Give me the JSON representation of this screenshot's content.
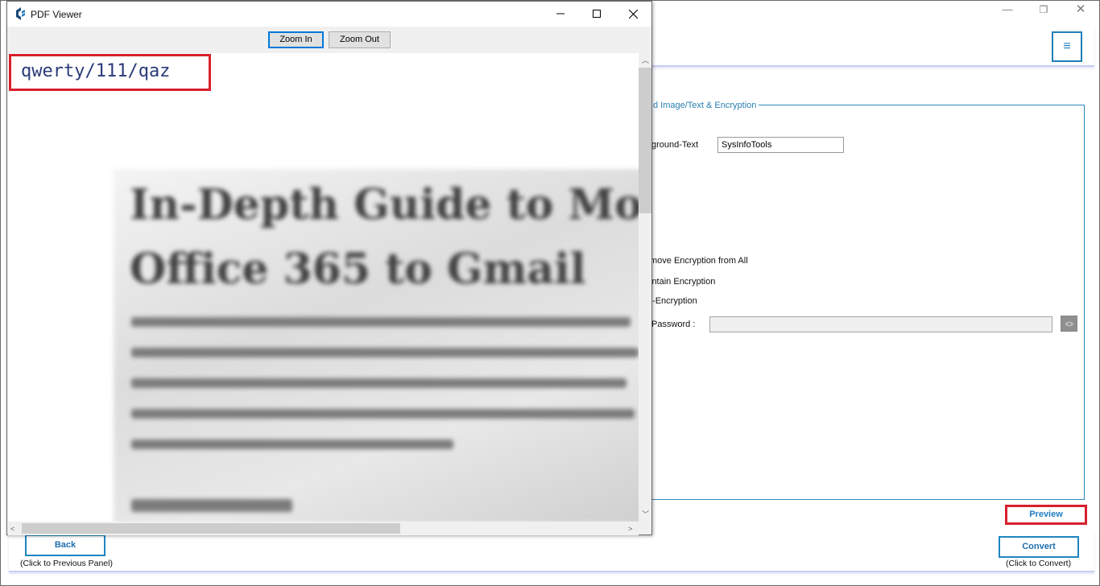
{
  "viewer": {
    "title": "PDF Viewer",
    "zoom_in_label": "Zoom In",
    "zoom_out_label": "Zoom Out",
    "watermark_text": "qwerty/111/qaz",
    "doc_heading_line1": "In-Depth Guide to Move",
    "doc_heading_line2": "Office 365 to Gmail"
  },
  "app": {
    "menu_glyph": "≡",
    "group_title": "d Image/Text & Encryption",
    "bg_text_label": "ground-Text",
    "bg_text_value": "SysInfoTools",
    "opt_remove": "move Encryption from All",
    "opt_maintain": "intain Encryption",
    "opt_set": "t-Encryption",
    "password_label": "Password :",
    "preview_label": "Preview",
    "back_label": "Back",
    "back_hint": "(Click to Previous Panel)",
    "convert_label": "Convert",
    "convert_hint": "(Click to Convert)"
  },
  "colors": {
    "accent_blue": "#1e7fb8",
    "highlight_red": "#d8202c",
    "watermark": "#2b3a78"
  }
}
